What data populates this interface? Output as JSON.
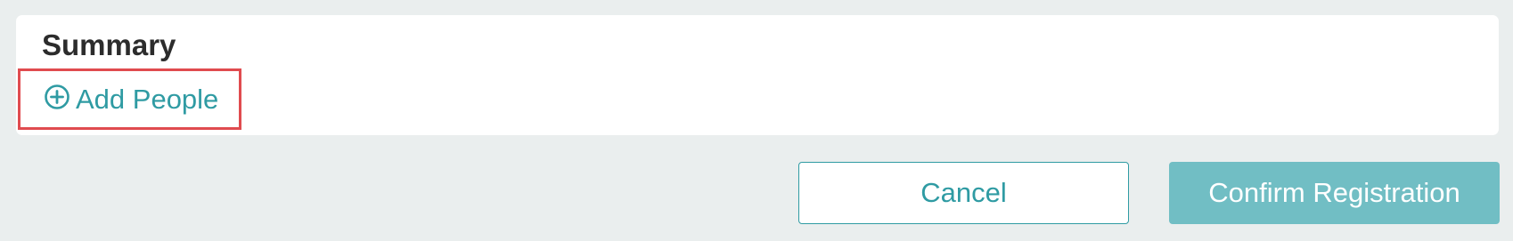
{
  "summary": {
    "title": "Summary",
    "add_people_label": "Add People",
    "add_people_icon": "plus-circle-icon"
  },
  "actions": {
    "cancel_label": "Cancel",
    "confirm_label": "Confirm Registration"
  },
  "colors": {
    "accent": "#2f9ba3",
    "confirm_button_bg": "#71bec4",
    "highlight_border": "#e04b4f",
    "page_background": "#eaeeee"
  }
}
